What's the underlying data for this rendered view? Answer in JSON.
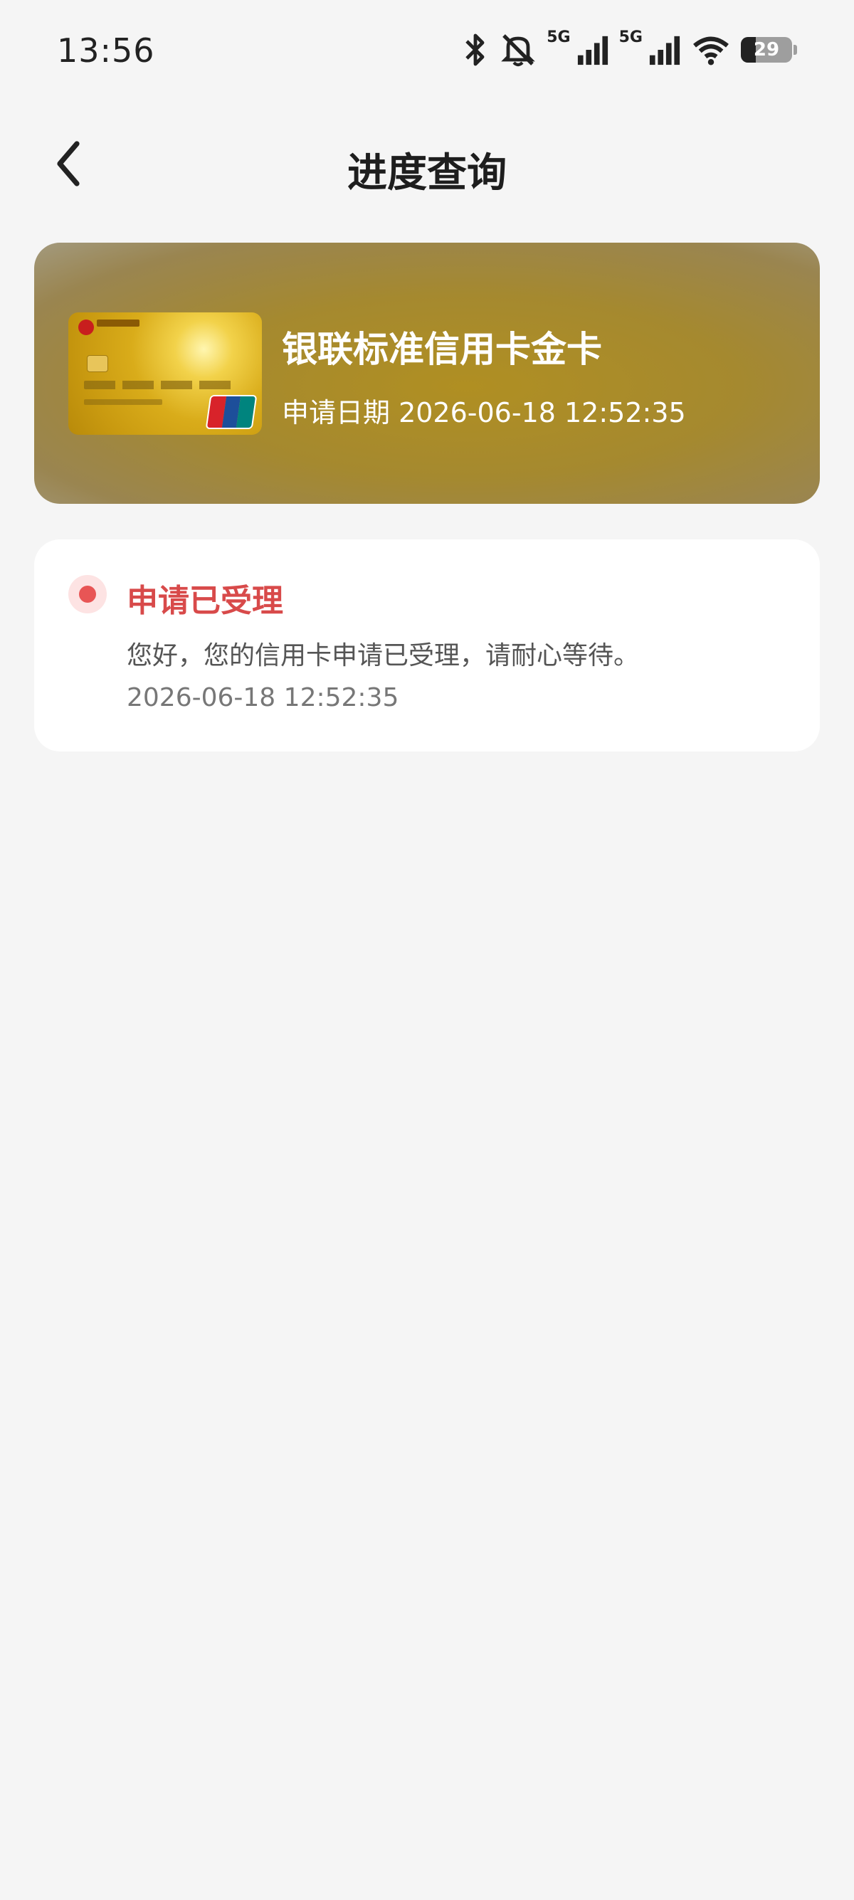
{
  "status_bar": {
    "time": "13:56",
    "net1": "5G",
    "net2": "5G",
    "wifi_sub": "6",
    "battery_level": 29,
    "battery_text": "29"
  },
  "header": {
    "back_icon": "chevron-left-icon",
    "title": "进度查询"
  },
  "card": {
    "name": "银联标准信用卡金卡",
    "apply_date": "申请日期 2026-06-18 12:52:35"
  },
  "status": {
    "title": "申请已受理",
    "message": "您好，您的信用卡申请已受理，请耐心等待。",
    "time": "2026-06-18 12:52:35",
    "accent_color": "#e85555"
  }
}
